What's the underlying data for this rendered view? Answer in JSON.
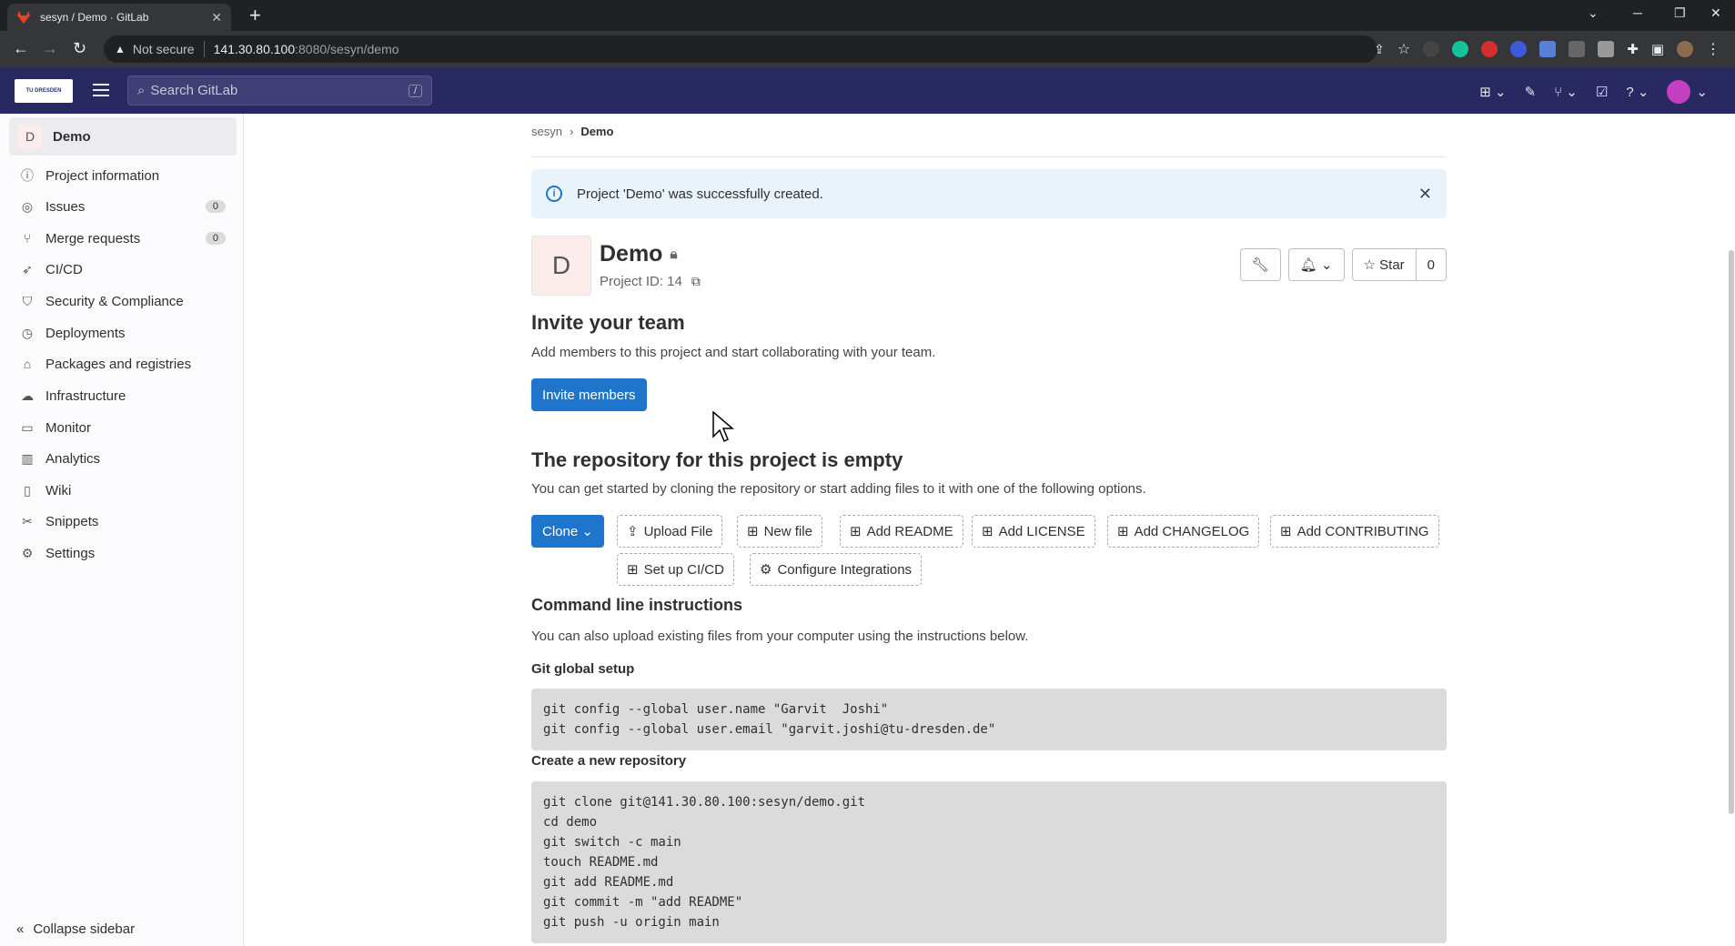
{
  "browser": {
    "tab_title": "sesyn / Demo · GitLab",
    "security_label": "Not secure",
    "url_host": "141.30.80.100",
    "url_path": ":8080/sesyn/demo"
  },
  "topbar": {
    "search_placeholder": "Search GitLab",
    "search_shortcut": "/"
  },
  "sidebar": {
    "project_initial": "D",
    "project_name": "Demo",
    "items": [
      {
        "label": "Project information",
        "icon": "info-icon"
      },
      {
        "label": "Issues",
        "icon": "issues-icon",
        "count": "0"
      },
      {
        "label": "Merge requests",
        "icon": "merge-request-icon",
        "count": "0"
      },
      {
        "label": "CI/CD",
        "icon": "rocket-icon"
      },
      {
        "label": "Security & Compliance",
        "icon": "shield-icon"
      },
      {
        "label": "Deployments",
        "icon": "deployments-icon"
      },
      {
        "label": "Packages and registries",
        "icon": "package-icon"
      },
      {
        "label": "Infrastructure",
        "icon": "cloud-icon"
      },
      {
        "label": "Monitor",
        "icon": "monitor-icon"
      },
      {
        "label": "Analytics",
        "icon": "chart-icon"
      },
      {
        "label": "Wiki",
        "icon": "book-icon"
      },
      {
        "label": "Snippets",
        "icon": "scissors-icon"
      },
      {
        "label": "Settings",
        "icon": "gear-icon"
      }
    ],
    "collapse_label": "Collapse sidebar"
  },
  "breadcrumb": {
    "parent": "sesyn",
    "current": "Demo"
  },
  "alert": {
    "message": "Project 'Demo' was successfully created."
  },
  "project": {
    "initial": "D",
    "name": "Demo",
    "id_label": "Project ID: 14",
    "star_label": "Star",
    "star_count": "0"
  },
  "invite": {
    "heading": "Invite your team",
    "text": "Add members to this project and start collaborating with your team.",
    "button": "Invite members"
  },
  "empty_repo": {
    "heading": "The repository for this project is empty",
    "text": "You can get started by cloning the repository or start adding files to it with one of the following options.",
    "clone_label": "Clone",
    "upload_file": "Upload File",
    "new_file": "New file",
    "add_readme": "Add README",
    "add_license": "Add LICENSE",
    "add_changelog": "Add CHANGELOG",
    "add_contributing": "Add CONTRIBUTING",
    "setup_cicd": "Set up CI/CD",
    "configure_integrations": "Configure Integrations"
  },
  "cli": {
    "heading": "Command line instructions",
    "text": "You can also upload existing files from your computer using the instructions below.",
    "global_setup_heading": "Git global setup",
    "global_setup_code": "git config --global user.name \"Garvit  Joshi\"\ngit config --global user.email \"garvit.joshi@tu-dresden.de\"",
    "new_repo_heading": "Create a new repository",
    "new_repo_code": "git clone git@141.30.80.100:sesyn/demo.git\ncd demo\ngit switch -c main\ntouch README.md\ngit add README.md\ngit commit -m \"add README\"\ngit push -u origin main"
  }
}
